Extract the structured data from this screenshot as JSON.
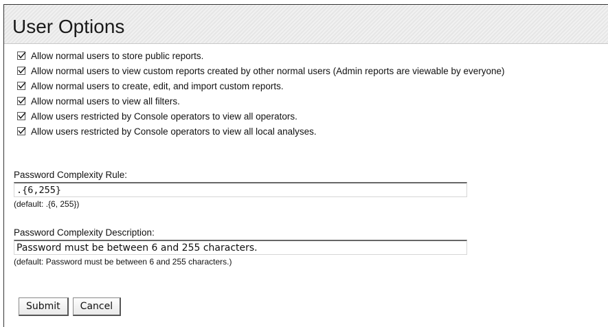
{
  "header": {
    "title": "User Options"
  },
  "options": [
    {
      "label": "Allow normal users to store public reports.",
      "checked": true
    },
    {
      "label": "Allow normal users to view custom reports created by other normal users (Admin reports are viewable by everyone)",
      "checked": true
    },
    {
      "label": "Allow normal users to create, edit, and import custom reports.",
      "checked": true
    },
    {
      "label": "Allow normal users to view all filters.",
      "checked": true
    },
    {
      "label": "Allow users restricted by Console operators to view all operators.",
      "checked": true
    },
    {
      "label": "Allow users restricted by Console operators to view all local analyses.",
      "checked": true
    }
  ],
  "password_rule": {
    "label": "Password Complexity Rule:",
    "value": ".{6,255}",
    "default_text": "(default: .{6, 255})"
  },
  "password_description": {
    "label": "Password Complexity Description:",
    "value": "Password must be between 6 and 255 characters.",
    "default_text": "(default: Password must be between 6 and 255 characters.)"
  },
  "buttons": {
    "submit_label": "Submit",
    "cancel_label": "Cancel"
  },
  "icons": {
    "checkbox": "checkmark-icon"
  }
}
